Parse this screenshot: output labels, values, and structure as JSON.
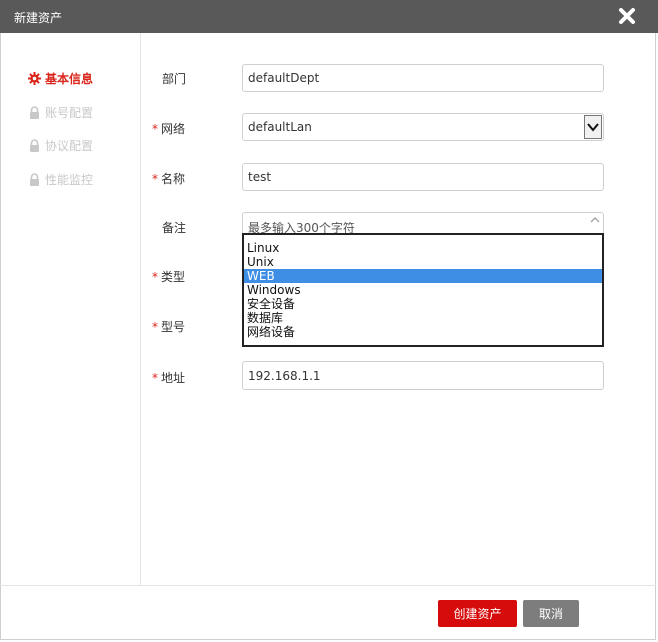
{
  "window": {
    "title": "新建资产"
  },
  "sidebar": {
    "items": [
      {
        "label": "基本信息",
        "icon": "gear-icon",
        "state": "active"
      },
      {
        "label": "账号配置",
        "icon": "lock-icon",
        "state": "disabled"
      },
      {
        "label": "协议配置",
        "icon": "lock-icon",
        "state": "disabled"
      },
      {
        "label": "性能监控",
        "icon": "lock-icon",
        "state": "disabled"
      }
    ]
  },
  "form": {
    "department": {
      "label": "部门",
      "value": "defaultDept"
    },
    "network": {
      "label": "网络",
      "value": "defaultLan",
      "required": "*"
    },
    "name": {
      "label": "名称",
      "value": "test",
      "required": "*"
    },
    "remark": {
      "label": "备注",
      "placeholder": "最多输入300个字符"
    },
    "type": {
      "label": "类型",
      "required": "*"
    },
    "model": {
      "label": "型号",
      "required": "*"
    },
    "address": {
      "label": "地址",
      "value": "192.168.1.1",
      "required": "*"
    }
  },
  "dropdown": {
    "options": [
      "Linux",
      "Unix",
      "WEB",
      "Windows",
      "安全设备",
      "数据库",
      "网络设备"
    ],
    "selected": "WEB"
  },
  "footer": {
    "create_label": "创建资产",
    "cancel_label": "取消"
  },
  "colors": {
    "accent": "#d9251c",
    "primary_button": "#d60c0c",
    "cancel_button": "#7d7d7d",
    "titlebar": "#595959",
    "selection": "#3e8ee6"
  }
}
